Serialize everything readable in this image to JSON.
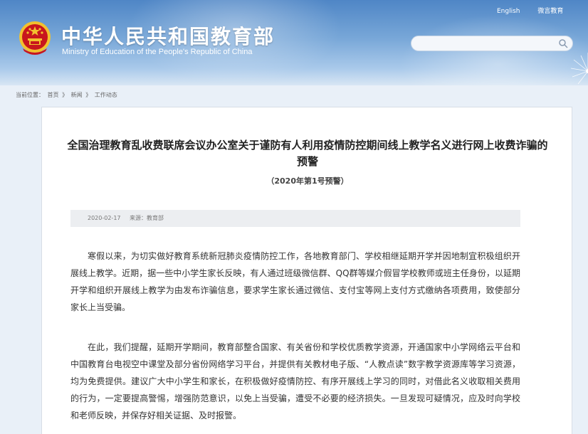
{
  "header": {
    "title_cn": "中华人民共和国教育部",
    "title_en": "Ministry of Education of the People's Republic of China",
    "links": {
      "english": "English",
      "weibo": "微言教育"
    },
    "search": {
      "placeholder": ""
    }
  },
  "breadcrumb": {
    "label": "当前位置：",
    "items": [
      "首页",
      "新闻",
      "工作动态"
    ],
    "separator": "》"
  },
  "article": {
    "title": "全国治理教育乱收费联席会议办公室关于谨防有人利用疫情防控期间线上教学名义进行网上收费诈骗的预警",
    "subtitle": "（2020年第1号预警）",
    "date": "2020-02-17",
    "source": "来源：教育部",
    "paragraphs": [
      "寒假以来，为切实做好教育系统新冠肺炎疫情防控工作，各地教育部门、学校相继延期开学并因地制宜积极组织开展线上教学。近期，据一些中小学生家长反映，有人通过班级微信群、QQ群等媒介假冒学校教师或班主任身份，以延期开学和组织开展线上教学为由发布诈骗信息，要求学生家长通过微信、支付宝等网上支付方式缴纳各项费用，致使部分家长上当受骗。",
      "在此，我们提醒，延期开学期间，教育部整合国家、有关省份和学校优质教学资源，开通国家中小学网络云平台和中国教育台电视空中课堂及部分省份网络学习平台，并提供有关教材电子版、“人教点读”数字教学资源库等学习资源，均为免费提供。建议广大中小学生和家长，在积极做好疫情防控、有序开展线上学习的同时，对借此名义收取相关费用的行为，一定要提高警惕，增强防范意识，以免上当受骗，遭受不必要的经济损失。一旦发现可疑情况，应及时向学校和老师反映，并保存好相关证据、及时报警。"
    ]
  },
  "colors": {
    "header_top": "#4f86c6",
    "header_bottom": "#d8e6f4",
    "page_bg": "#e9f0f8",
    "emblem_red": "#c8161d",
    "emblem_gold": "#f2c12e"
  }
}
